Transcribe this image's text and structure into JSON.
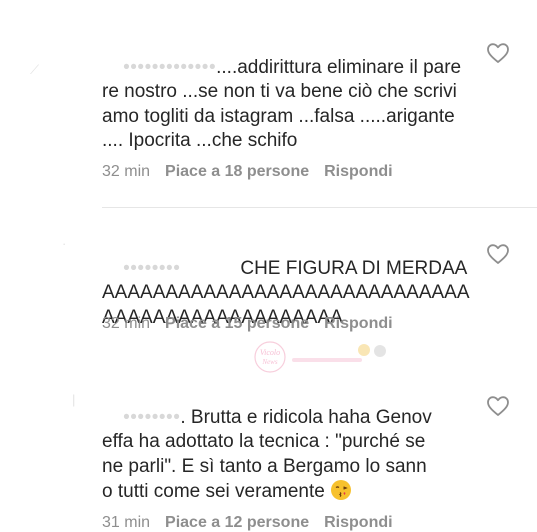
{
  "comments": [
    {
      "username": "•••••••••••••",
      "text": "....addirittura eliminare il parere nostro ...se non ti va bene ciò che scriviamo togliti da istagram ...falsa .....arigante .... Ipocrita ...che schifo",
      "time": "32 min",
      "likes": "Piace a 18 persone",
      "reply": "Rispondi"
    },
    {
      "username": "••••••••",
      "text": "CHE FIGURA DI MERDAAAAAAAAAAAAAAAAAAAAAAAAAAAAAAAAAAAAAAAAAAAAAAAAAA",
      "time": "32 min",
      "likes": "Piace a 15 persone",
      "reply": "Rispondi"
    },
    {
      "username": "••••••••",
      "text": ". Brutta e ridicola haha Genoveffa ha adottato la tecnica : \"purché se ne parli\". E sì tanto a Bergamo lo sanno tutti come sei veramente",
      "emoji": "kissing-face-emoji",
      "time": "31 min",
      "likes": "Piace a 12 persone",
      "reply": "Rispondi"
    }
  ],
  "watermark": {
    "brand": "Vicolo delle News"
  },
  "colors": {
    "text": "#262626",
    "meta": "#8e8e8e",
    "divider": "#e6e6e6"
  }
}
